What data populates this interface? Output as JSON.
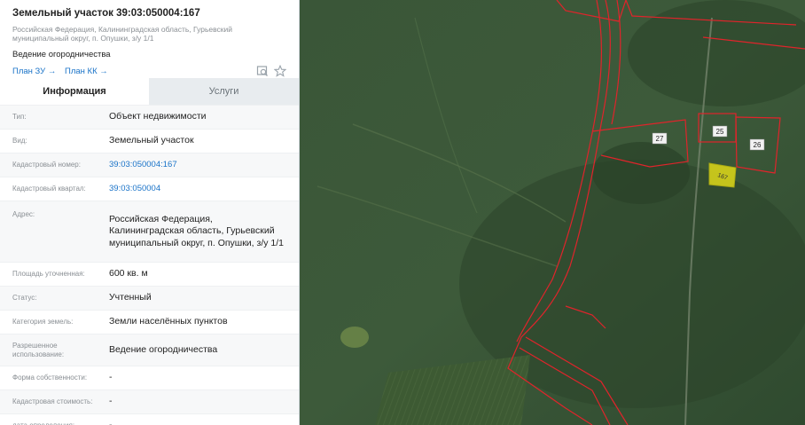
{
  "header": {
    "title": "Земельный участок 39:03:050004:167",
    "address": "Российская Федерация, Калининградская область, Гурьевский муниципальный округ, п. Опушки, з/у 1/1",
    "purpose": "Ведение огородничества",
    "plan_zu": "План ЗУ →",
    "plan_kk": "План КК →"
  },
  "tabs": {
    "info": "Информация",
    "services": "Услуги"
  },
  "rows": [
    {
      "label": "Тип:",
      "value": "Объект недвижимости"
    },
    {
      "label": "Вид:",
      "value": "Земельный участок"
    },
    {
      "label": "Кадастровый номер:",
      "value": "39:03:050004:167"
    },
    {
      "label": "Кадастровый квартал:",
      "value": "39:03:050004"
    },
    {
      "label": "Адрес:",
      "value": "Российская Федерация, Калининградская область, Гурьевский муниципальный округ, п. Опушки, з/у 1/1"
    },
    {
      "label": "Площадь уточненная:",
      "value": "600 кв. м"
    },
    {
      "label": "Статус:",
      "value": "Учтенный"
    },
    {
      "label": "Категория земель:",
      "value": "Земли населённых пунктов"
    },
    {
      "label": "Разрешенное использование:",
      "value": "Ведение огородничества"
    },
    {
      "label": "Форма собственности:",
      "value": "-"
    },
    {
      "label": "Кадастровая стоимость:",
      "value": "-"
    },
    {
      "label": "дата определения:",
      "value": "-"
    }
  ],
  "map": {
    "parcel_labels": [
      "27",
      "25",
      "26",
      "167"
    ],
    "boundary_color": "#e0242b",
    "highlight_color": "#d6d21a"
  },
  "icons": [
    "search-map-icon",
    "star-icon"
  ]
}
